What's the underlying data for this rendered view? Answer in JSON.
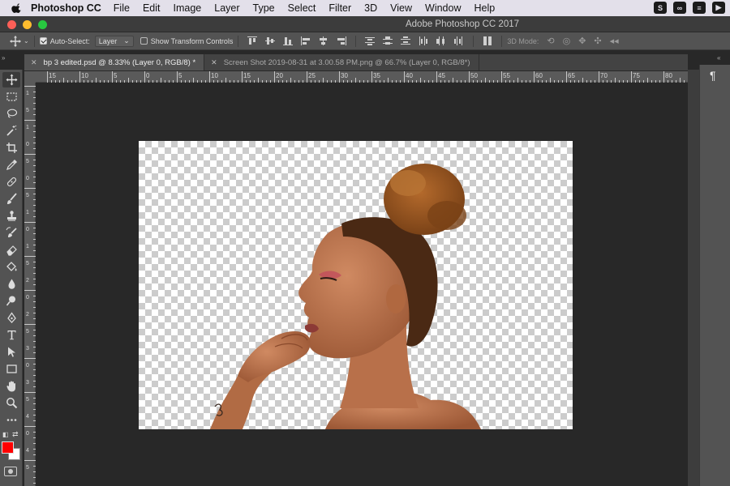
{
  "menubar": {
    "app_name": "Photoshop CC",
    "items": [
      "File",
      "Edit",
      "Image",
      "Layer",
      "Type",
      "Select",
      "Filter",
      "3D",
      "View",
      "Window",
      "Help"
    ],
    "tray_icons": [
      "skype-icon",
      "creative-cloud-icon",
      "wallet-icon",
      "flag-icon"
    ]
  },
  "window": {
    "title": "Adobe Photoshop CC 2017",
    "traffic_lights": [
      "#fd5f57",
      "#febc2e",
      "#28c840"
    ]
  },
  "options": {
    "auto_select_label": "Auto-Select:",
    "auto_select_checked": true,
    "target_value": "Layer",
    "show_transform_label": "Show Transform Controls",
    "show_transform_checked": false,
    "mode_3d_label": "3D Mode:"
  },
  "tabs": [
    {
      "label": "bp 3 edited.psd @ 8.33% (Layer 0, RGB/8) *",
      "active": true
    },
    {
      "label": "Screen Shot 2019-08-31 at 3.00.58 PM.png @ 66.7% (Layer 0, RGB/8*)",
      "active": false
    }
  ],
  "rulers": {
    "horizontal": [
      "15",
      "10",
      "5",
      "0",
      "5",
      "10",
      "15",
      "20",
      "25",
      "30",
      "35",
      "40",
      "45",
      "50",
      "55",
      "60",
      "65",
      "70",
      "75",
      "80"
    ],
    "vertical": [
      "1",
      "5",
      "1",
      "0",
      "5",
      "0",
      "5",
      "1",
      "0",
      "1",
      "5",
      "2",
      "0",
      "2",
      "5",
      "3",
      "0",
      "3",
      "5",
      "4",
      "0",
      "4",
      "5"
    ]
  },
  "tools": [
    "move-tool",
    "marquee-tool",
    "lasso-tool",
    "quick-selection-tool",
    "crop-tool",
    "eyedropper-tool",
    "healing-brush-tool",
    "brush-tool",
    "clone-stamp-tool",
    "history-brush-tool",
    "eraser-tool",
    "paint-bucket-tool",
    "blur-tool",
    "dodge-tool",
    "pen-tool",
    "type-tool",
    "path-selection-tool",
    "rectangle-tool",
    "hand-tool",
    "zoom-tool",
    "more-tools"
  ],
  "colors": {
    "foreground": "#ff0000",
    "background": "#ffffff",
    "ui_dark": "#282828",
    "ui_panel": "#535353"
  },
  "right_panel": {
    "icon": "paragraph-icon"
  }
}
